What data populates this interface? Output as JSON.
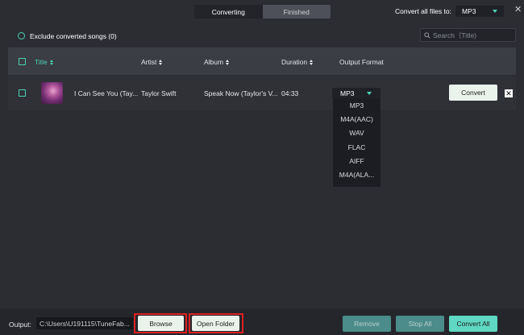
{
  "tabs": [
    {
      "label": "Converting",
      "active": true
    },
    {
      "label": "Finished",
      "active": false
    }
  ],
  "convert_all": {
    "label": "Convert all files to:",
    "value": "MP3"
  },
  "close_icon": "close-icon",
  "filter": {
    "exclude_label": "Exclude converted songs (0)"
  },
  "search": {
    "placeholder": "Search（Title)"
  },
  "table": {
    "headers": {
      "title": "Title",
      "artist": "Artist",
      "album": "Album",
      "duration": "Duration",
      "output_format": "Output Format"
    },
    "rows": [
      {
        "title": "I Can See You (Tay...",
        "artist": "Taylor Swift",
        "album": "Speak Now (Taylor's V...",
        "duration": "04:33",
        "format": "MP3",
        "convert_label": "Convert"
      }
    ]
  },
  "format_options": [
    "MP3",
    "M4A(AAC)",
    "WAV",
    "FLAC",
    "AIFF",
    "M4A(ALA..."
  ],
  "bottom": {
    "output_label": "Output:",
    "output_path": "C:\\Users\\U191115\\TuneFab...",
    "browse": "Browse",
    "open_folder": "Open Folder",
    "remove": "Remove",
    "stop_all": "Stop All",
    "convert_all": "Convert All"
  },
  "colors": {
    "accent": "#4fd1b5",
    "background": "#2b2d33",
    "highlight": "#e02020"
  }
}
